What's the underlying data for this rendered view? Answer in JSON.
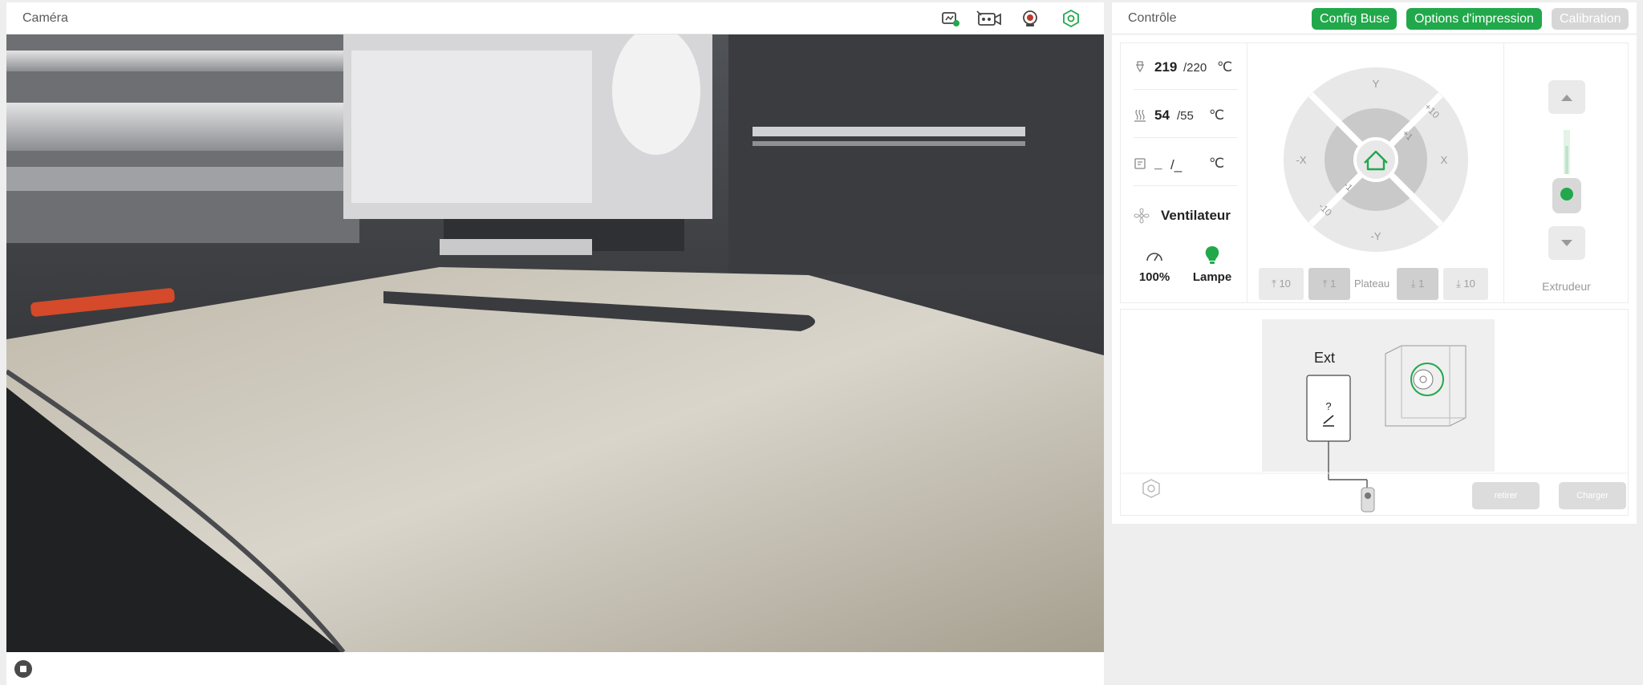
{
  "camera": {
    "title": "Caméra",
    "icons": [
      "monitoring-icon",
      "recording-icon",
      "webcam-icon",
      "settings-icon"
    ]
  },
  "control": {
    "title": "Contrôle",
    "buttons": {
      "nozzle": "Config Buse",
      "print_options": "Options d'impression",
      "calibration": "Calibration"
    },
    "nozzle_temp": {
      "current": "219",
      "target": "/220",
      "unit": "℃"
    },
    "bed_temp": {
      "current": "54",
      "target": "/55",
      "unit": "℃"
    },
    "chamber_temp": {
      "current": "_",
      "target": "/_",
      "unit": "℃"
    },
    "fan_label": "Ventilateur",
    "speed_value": "100%",
    "lamp_label": "Lampe",
    "jog": {
      "y_plus": "Y",
      "y_minus": "-Y",
      "x_plus": "X",
      "x_minus": "-X",
      "plus10": "+10",
      "plus1": "+1",
      "minus1": "-1",
      "minus10": "-10"
    },
    "plate": {
      "label": "Plateau",
      "up10": "10",
      "up1": "1",
      "down1": "1",
      "down10": "10"
    },
    "extruder_label": "Extrudeur"
  },
  "filament": {
    "ext_label": "Ext",
    "unknown": "?",
    "unload_label": "retirer",
    "load_label": "Charger"
  },
  "colors": {
    "accent": "#21a84b",
    "disabled": "#d6d6d6"
  }
}
